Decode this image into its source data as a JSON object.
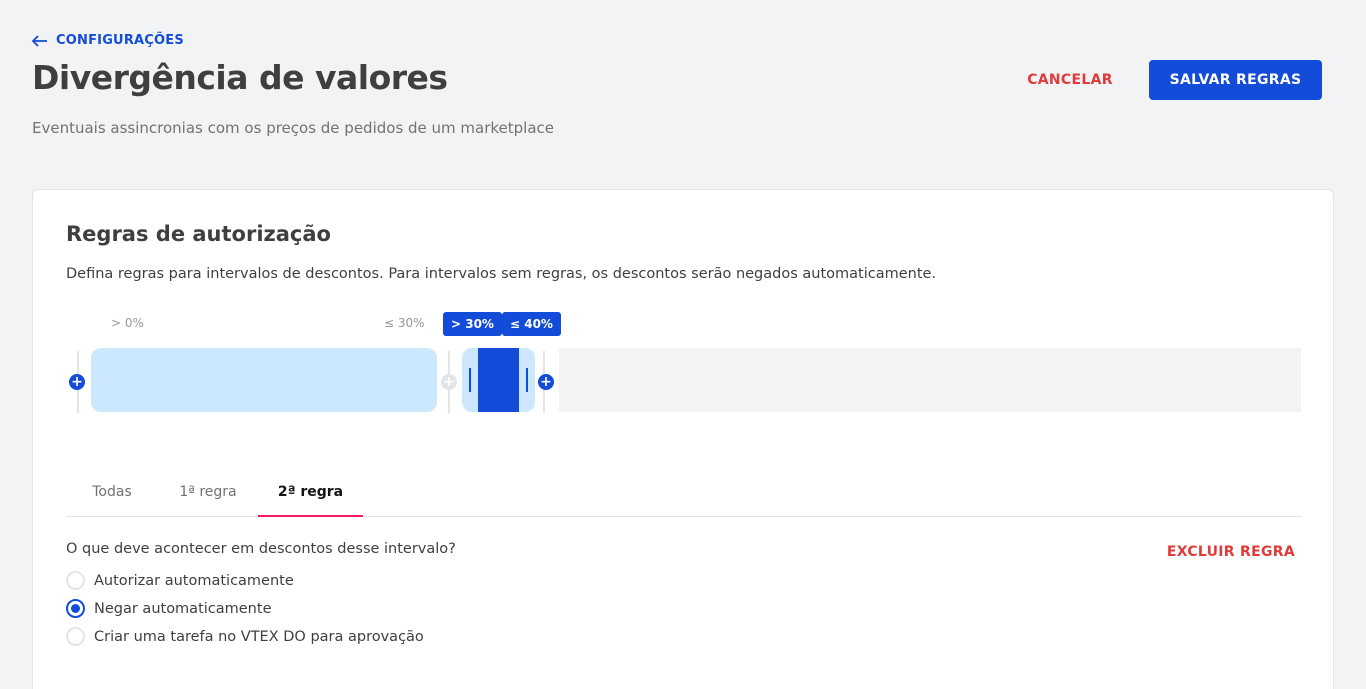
{
  "header": {
    "back_label": "CONFIGURAÇÕES",
    "title": "Divergência de valores",
    "subtitle": "Eventuais assincronias com os preços de pedidos de um marketplace",
    "cancel_label": "CANCELAR",
    "save_label": "SALVAR REGRAS"
  },
  "card": {
    "title": "Regras de autorização",
    "description": "Defina regras para intervalos de descontos. Para intervalos sem regras, os descontos serão negados automaticamente.",
    "ranges": [
      {
        "min_label": "> 0%",
        "max_label": "≤ 30%",
        "selected": false
      },
      {
        "min_label": "> 30%",
        "max_label": "≤ 40%",
        "selected": true
      }
    ]
  },
  "tabs": [
    {
      "label": "Todas",
      "active": false
    },
    {
      "label": "1ª regra",
      "active": false
    },
    {
      "label": "2ª regra",
      "active": true
    }
  ],
  "rule": {
    "question": "O que deve acontecer em descontos desse intervalo?",
    "delete_label": "EXCLUIR REGRA",
    "options": [
      {
        "label": "Autorizar automaticamente",
        "checked": false
      },
      {
        "label": "Negar automaticamente",
        "checked": true
      },
      {
        "label": "Criar uma tarefa no VTEX DO para aprovação",
        "checked": false
      }
    ]
  },
  "colors": {
    "accent": "#134cd8",
    "danger": "#e13a3a",
    "range_fill": "#cce8ff",
    "tab_indicator": "#f71963"
  }
}
